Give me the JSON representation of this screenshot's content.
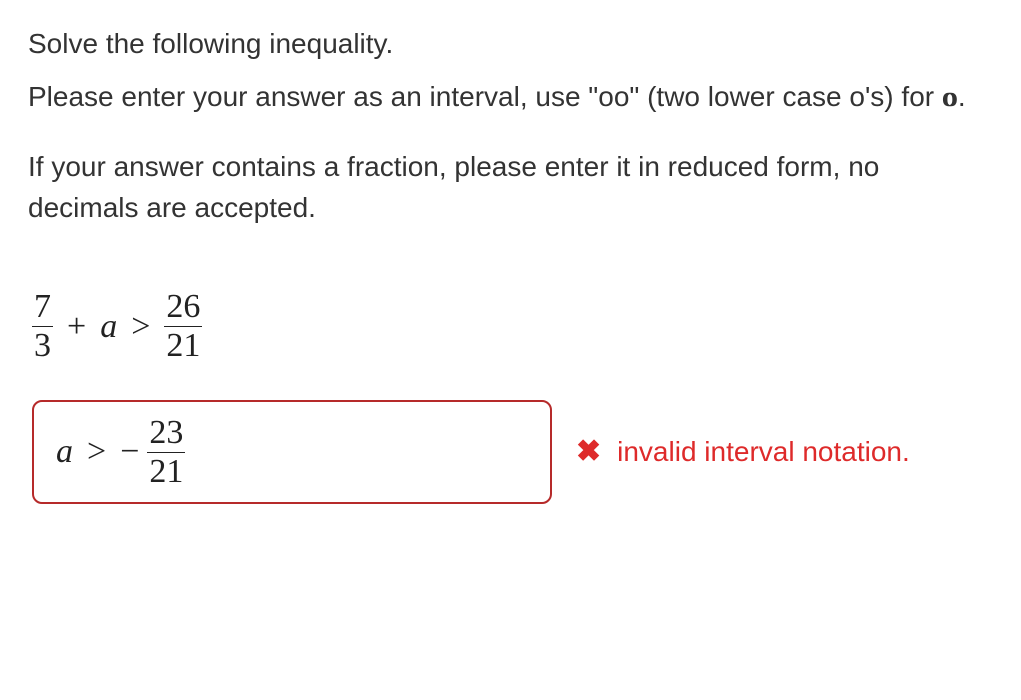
{
  "problem": {
    "prompt": "Solve the following inequality.",
    "instruction1a": "Please enter your answer as an interval, use \"oo\" (two lower case o's) for ",
    "instruction1b": ".",
    "instruction2": "If your answer contains a fraction, please enter it in reduced form, no decimals are accepted."
  },
  "inequality": {
    "lhs_frac_num": "7",
    "lhs_frac_den": "3",
    "plus": "+",
    "var": "a",
    "relation": ">",
    "rhs_frac_num": "26",
    "rhs_frac_den": "21"
  },
  "answer": {
    "var": "a",
    "relation": ">",
    "minus": "−",
    "frac_num": "23",
    "frac_den": "21"
  },
  "feedback": {
    "icon_label": "✖",
    "message": "invalid interval notation."
  }
}
